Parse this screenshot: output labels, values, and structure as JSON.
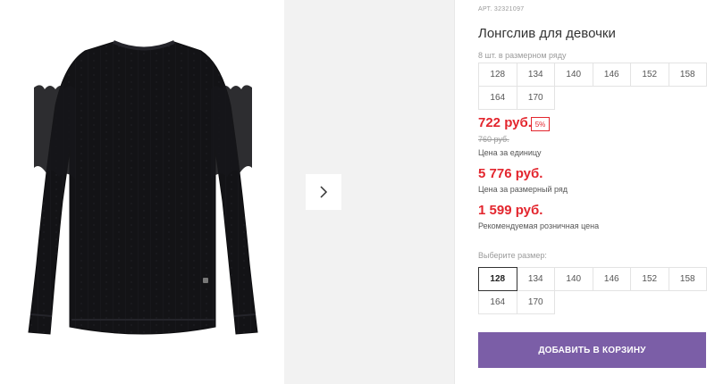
{
  "product": {
    "sku": "АРТ. 32321097",
    "title": "Лонгслив для девочки"
  },
  "size_set": {
    "label": "8 шт. в размерном ряду",
    "sizes": [
      "128",
      "134",
      "140",
      "146",
      "152",
      "158",
      "164",
      "170"
    ]
  },
  "pricing": {
    "unit_price": "722 руб.",
    "discount": "5%",
    "old_price": "760 руб.",
    "unit_caption": "Цена за единицу",
    "set_price": "5 776 руб.",
    "set_caption": "Цена за размерный ряд",
    "rrp_price": "1 599 руб.",
    "rrp_caption": "Рекомендуемая розничная цена"
  },
  "size_select": {
    "label": "Выберите размер:",
    "selected": "128",
    "sizes": [
      "128",
      "134",
      "140",
      "146",
      "152",
      "158",
      "164",
      "170"
    ]
  },
  "actions": {
    "add_to_cart": "ДОБАВИТЬ В КОРЗИНУ"
  },
  "icons": {
    "next": "chevron-right-icon"
  },
  "colors": {
    "price_red": "#e3262e",
    "button_purple": "#7b5ea7",
    "garment": "#131316"
  }
}
